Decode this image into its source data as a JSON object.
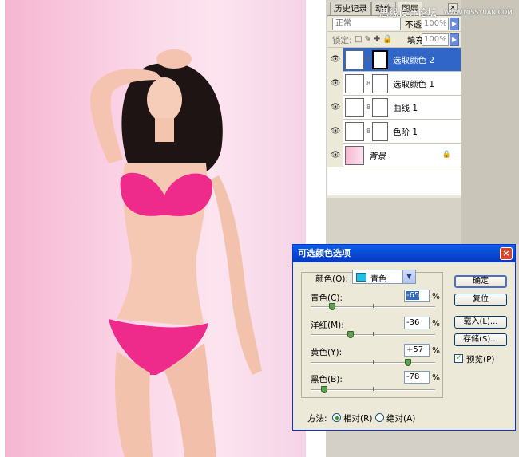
{
  "panel": {
    "tabs": [
      "历史记录",
      "动作",
      "图层"
    ],
    "tab_close": "×",
    "blend_mode": "正常",
    "opacity_label": "不透明度:",
    "opacity_value": "100%",
    "lock_label": "锁定:",
    "fill_label": "填充:",
    "fill_value": "100%",
    "layers": [
      {
        "name": "选取颜色 2",
        "selected": true
      },
      {
        "name": "选取颜色 1",
        "selected": false
      },
      {
        "name": "曲线 1",
        "selected": false
      },
      {
        "name": "色阶 1",
        "selected": false
      },
      {
        "name": "背景",
        "selected": false
      }
    ]
  },
  "watermark": {
    "text": "思缘设计论坛",
    "url": "WWW.MISSYUAN.COM"
  },
  "dialog": {
    "title": "可选颜色选项",
    "close": "×",
    "color_label": "颜色(O):",
    "color_value": "青色",
    "swatch_color": "#21c1e6",
    "sliders": [
      {
        "label": "青色(C):",
        "value": "-65",
        "percent": -65
      },
      {
        "label": "洋红(M):",
        "value": "-36",
        "percent": -36
      },
      {
        "label": "黄色(Y):",
        "value": "+57",
        "percent": 57
      },
      {
        "label": "黑色(B):",
        "value": "-78",
        "percent": -78
      }
    ],
    "pct_sign": "%",
    "buttons": {
      "ok": "确定",
      "reset": "复位",
      "load": "载入(L)...",
      "save": "存储(S)..."
    },
    "preview_label": "预览(P)",
    "method_label": "方法:",
    "relative_label": "相对(R)",
    "absolute_label": "绝对(A)"
  }
}
